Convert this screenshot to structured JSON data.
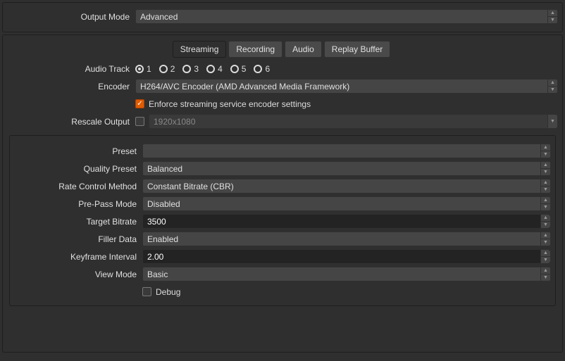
{
  "topRow": {
    "outputModeLabel": "Output Mode",
    "outputMode": "Advanced"
  },
  "tabs": {
    "streaming": "Streaming",
    "recording": "Recording",
    "audio": "Audio",
    "replayBuffer": "Replay Buffer",
    "active": "streaming"
  },
  "streaming": {
    "audioTrackLabel": "Audio Track",
    "audioTracks": [
      "1",
      "2",
      "3",
      "4",
      "5",
      "6"
    ],
    "audioTrackSelected": "1",
    "encoderLabel": "Encoder",
    "encoder": "H264/AVC Encoder (AMD Advanced Media Framework)",
    "enforceLabel": "Enforce streaming service encoder settings",
    "enforceChecked": true,
    "rescaleLabel": "Rescale Output",
    "rescaleChecked": false,
    "rescalePlaceholder": "1920x1080"
  },
  "encoder": {
    "presetLabel": "Preset",
    "preset": "",
    "qualityPresetLabel": "Quality Preset",
    "qualityPreset": "Balanced",
    "rateControlLabel": "Rate Control Method",
    "rateControl": "Constant Bitrate (CBR)",
    "prePassLabel": "Pre-Pass Mode",
    "prePass": "Disabled",
    "targetBitrateLabel": "Target Bitrate",
    "targetBitrate": "3500",
    "fillerDataLabel": "Filler Data",
    "fillerData": "Enabled",
    "keyframeLabel": "Keyframe Interval",
    "keyframe": "2.00",
    "viewModeLabel": "View Mode",
    "viewMode": "Basic",
    "debugLabel": "Debug",
    "debugChecked": false
  }
}
